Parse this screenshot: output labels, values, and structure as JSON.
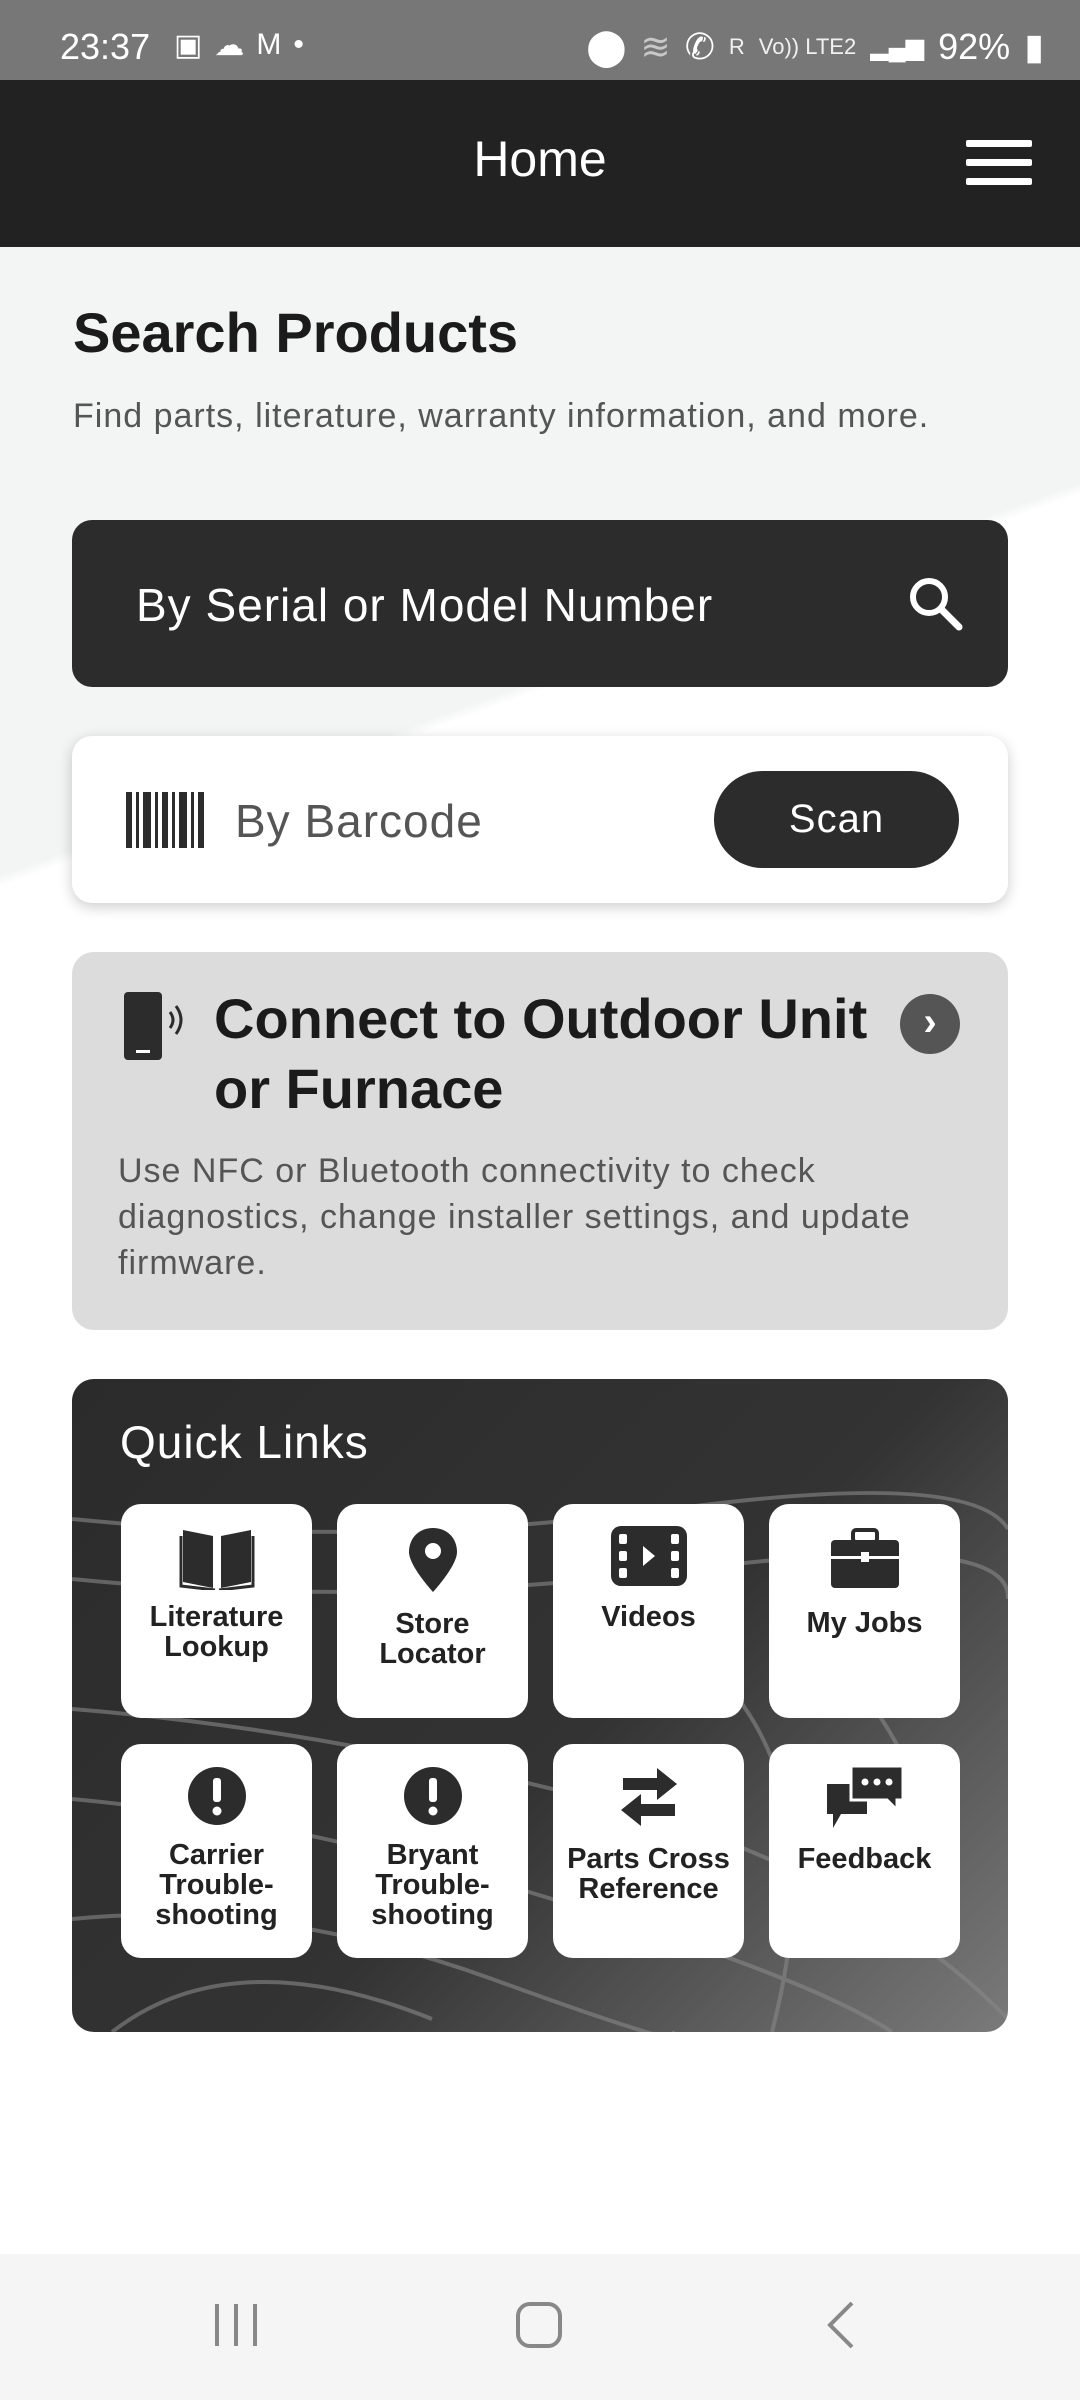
{
  "status_bar": {
    "time": "23:37",
    "battery": "92%",
    "icons": [
      "gallery-icon",
      "cloud-icon",
      "gmail-icon",
      "dot-icon",
      "location-icon",
      "wifi-icon",
      "wifi-call-icon",
      "signal-icon",
      "volte-icon",
      "battery-charging-icon"
    ],
    "volte": "Vo)) LTE2",
    "roaming": "R"
  },
  "header": {
    "title": "Home",
    "menu_icon": "hamburger-icon"
  },
  "search": {
    "title": "Search Products",
    "subtitle": "Find parts, literature, warranty information, and more.",
    "serial_label": "By Serial or Model Number",
    "barcode_label": "By Barcode",
    "scan_label": "Scan"
  },
  "connect": {
    "title": "Connect to Outdoor Unit or Furnace",
    "description": "Use NFC or Bluetooth connectivity to check diagnostics, change installer settings, and update firmware."
  },
  "quick_links": {
    "title": "Quick Links",
    "items": [
      {
        "label": "Literature Lookup",
        "icon": "book-icon"
      },
      {
        "label": "Store Locator",
        "icon": "map-pin-icon"
      },
      {
        "label": "Videos",
        "icon": "film-icon"
      },
      {
        "label": "My Jobs",
        "icon": "briefcase-icon"
      },
      {
        "label": "Carrier Trouble-shooting",
        "icon": "alert-icon"
      },
      {
        "label": "Bryant Trouble-shooting",
        "icon": "alert-icon"
      },
      {
        "label": "Parts Cross Reference",
        "icon": "swap-icon"
      },
      {
        "label": "Feedback",
        "icon": "chat-icon"
      }
    ]
  },
  "colors": {
    "header": "#232222",
    "dark_button": "#2c2c2c",
    "card_gray": "#dcdcdc"
  }
}
